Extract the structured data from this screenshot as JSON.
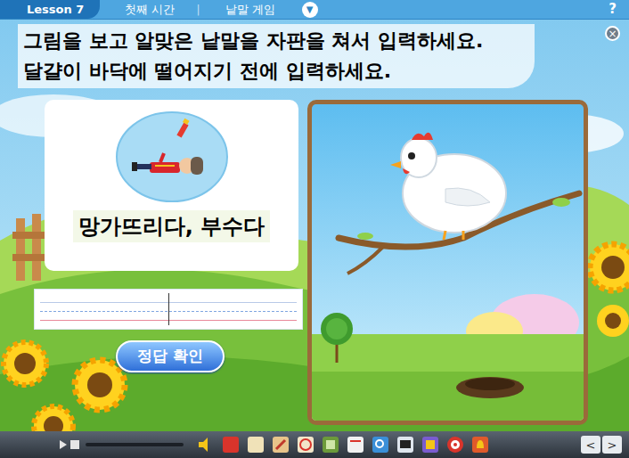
{
  "header": {
    "lesson": "Lesson 7",
    "period": "첫째 시간",
    "separator": "|",
    "activity": "낱말 게임",
    "menu_icon": "▼",
    "help": "?",
    "close_icon": "×"
  },
  "instructions": [
    "그림을 보고 알맞은 낱말을 자판을 쳐서 입력하세요.",
    "달걀이 바닥에 떨어지기 전에 입력하세요."
  ],
  "word_card": {
    "meaning": "망가뜨리다, 부수다"
  },
  "check_button": "정답 확인",
  "toolbar": {
    "nav": [
      "<",
      ">"
    ]
  }
}
